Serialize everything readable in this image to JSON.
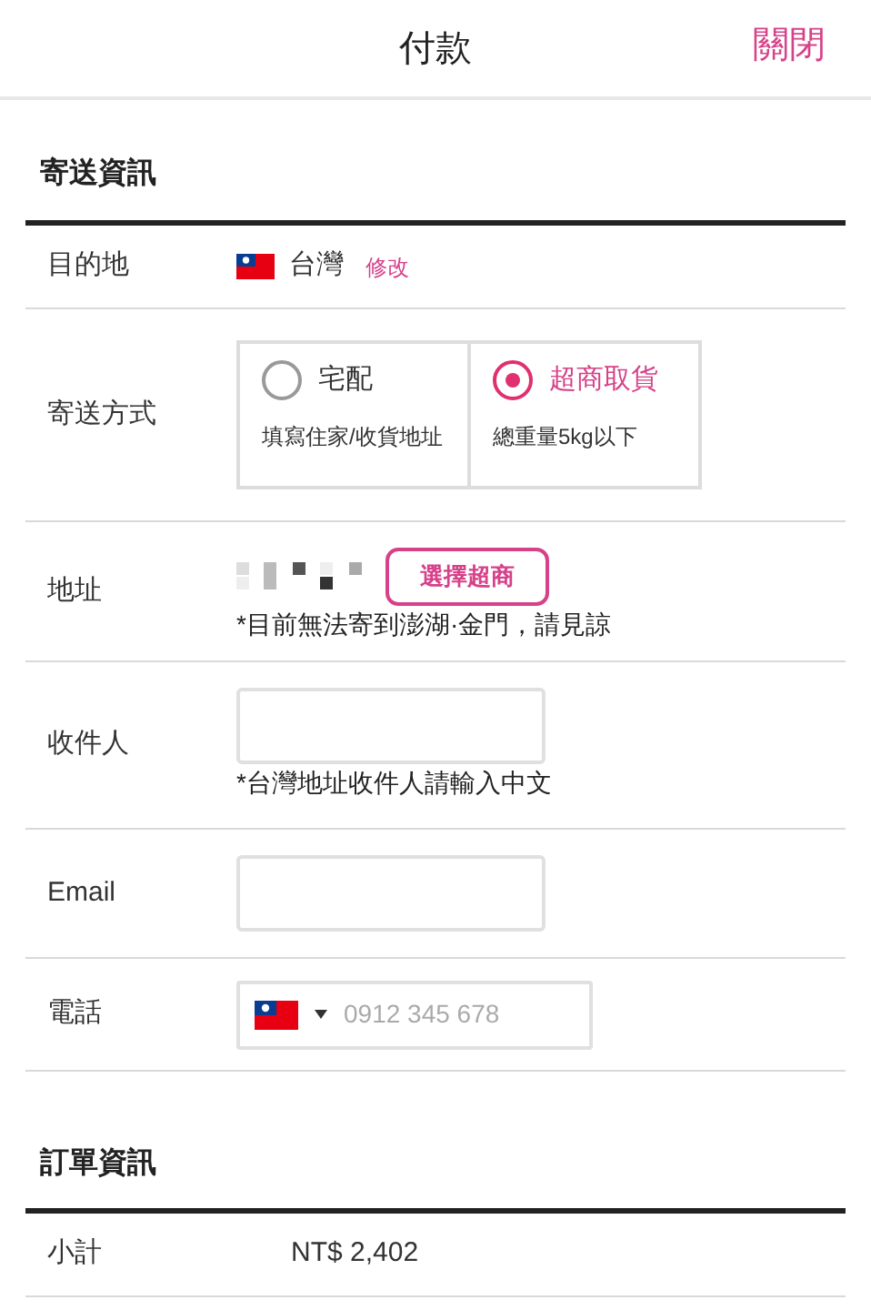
{
  "header": {
    "title": "付款",
    "close": "關閉"
  },
  "shipping": {
    "title": "寄送資訊",
    "destination": {
      "label": "目的地",
      "country": "台灣",
      "edit": "修改"
    },
    "method": {
      "label": "寄送方式",
      "options": [
        {
          "name": "宅配",
          "note": "填寫住家/收貨地址",
          "selected": false
        },
        {
          "name": "超商取貨",
          "note": "總重量5kg以下",
          "selected": true
        }
      ]
    },
    "address": {
      "label": "地址",
      "button": "選擇超商",
      "note": "*目前無法寄到澎湖·金門，請見諒"
    },
    "fields": [
      {
        "kind": "text",
        "label": "收件人",
        "note": "*台灣地址收件人請輸入中文"
      },
      {
        "kind": "text",
        "label": "Email"
      },
      {
        "kind": "phone",
        "label": "電話",
        "placeholder": "0912 345 678"
      }
    ]
  },
  "order": {
    "title": "訂單資訊",
    "rows": [
      {
        "label": "小計",
        "value": "NT$ 2,402"
      }
    ]
  }
}
